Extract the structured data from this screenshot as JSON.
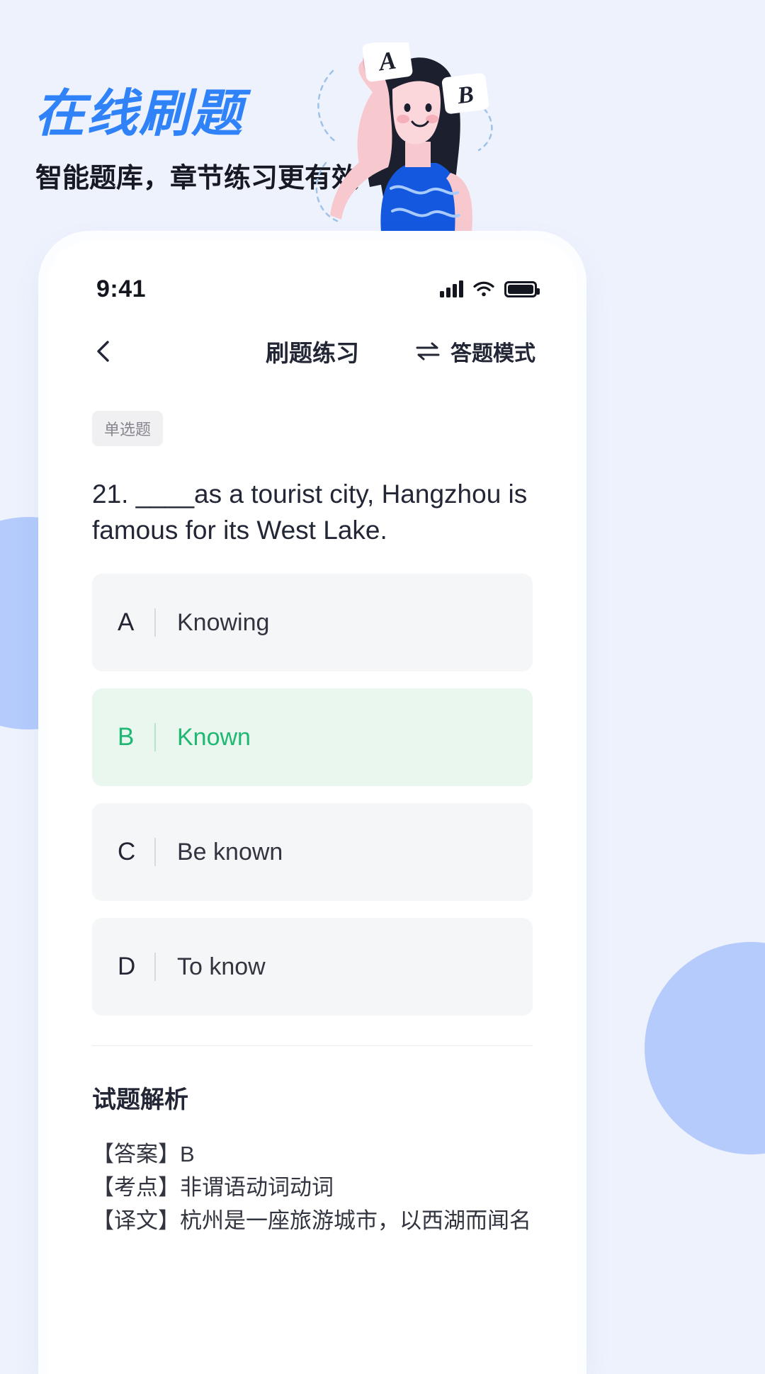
{
  "promo": {
    "headline": "在线刷题",
    "subhead": "智能题库，章节练习更有效",
    "accent_blue": "#2f82f7",
    "bubble_a": "A",
    "bubble_b": "B"
  },
  "statusbar": {
    "time": "9:41",
    "signal_icon": "signal-bars-icon",
    "wifi_icon": "wifi-icon",
    "battery_icon": "battery-icon"
  },
  "navbar": {
    "back_icon": "chevron-left-icon",
    "title": "刷题练习",
    "mode_icon": "swap-arrows-icon",
    "mode_label": "答题模式"
  },
  "question": {
    "tag": "单选题",
    "text": "21.  ____as a tourist city, Hangzhou is famous for its West Lake.",
    "options": [
      {
        "key": "A",
        "text": "Knowing",
        "state": "normal"
      },
      {
        "key": "B",
        "text": "Known",
        "state": "correct"
      },
      {
        "key": "C",
        "text": "Be known",
        "state": "normal"
      },
      {
        "key": "D",
        "text": "To know",
        "state": "normal"
      }
    ],
    "correct_color": "#1fb872"
  },
  "analysis": {
    "title": "试题解析",
    "lines": [
      "【答案】B",
      "【考点】非谓语动词动词",
      "【译文】杭州是一座旅游城市，以西湖而闻名"
    ]
  }
}
